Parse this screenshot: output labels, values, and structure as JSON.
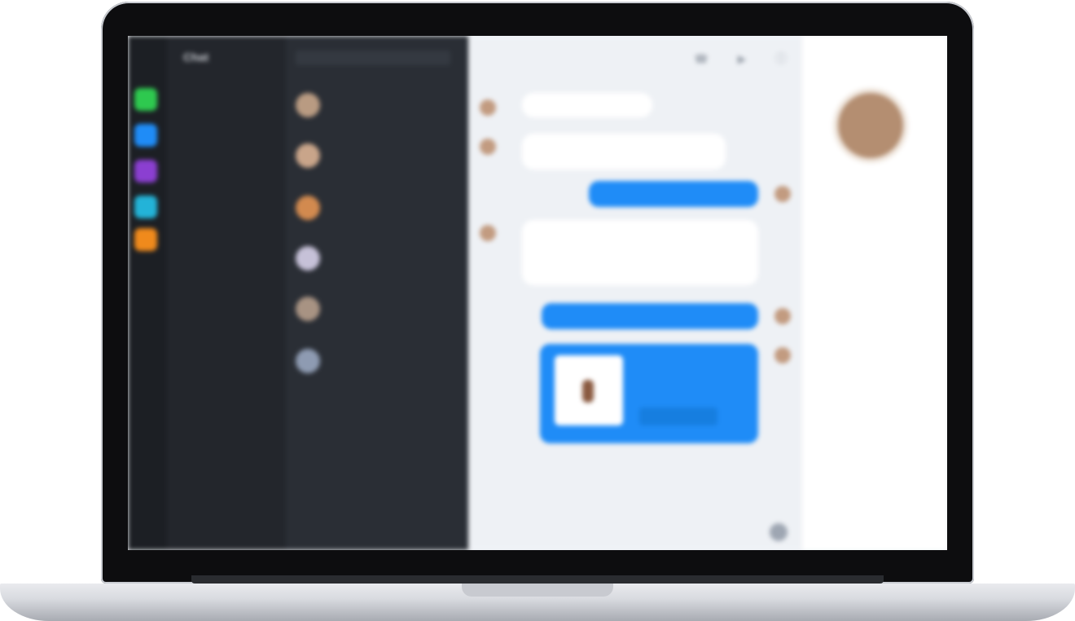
{
  "app": {
    "brand": "Chat",
    "menu_items": [
      "",
      "",
      "",
      "",
      "",
      "",
      "",
      "",
      ""
    ],
    "rail_colors": [
      "#2ec94f",
      "#1f8cf7",
      "#8b3fd1",
      "#23b3d8",
      "#f08a1c"
    ],
    "conversations": [
      {
        "name": "",
        "preview": ""
      },
      {
        "name": "",
        "preview": ""
      },
      {
        "name": "",
        "preview": ""
      },
      {
        "name": "",
        "preview": ""
      },
      {
        "name": "",
        "preview": ""
      },
      {
        "name": "",
        "preview": ""
      }
    ],
    "chat": {
      "title": "",
      "messages": [
        {
          "dir": "in",
          "text": ""
        },
        {
          "dir": "in",
          "text": ""
        },
        {
          "dir": "out",
          "text": ""
        },
        {
          "dir": "in",
          "text": ""
        },
        {
          "dir": "out",
          "text": ""
        }
      ],
      "card": {
        "line1": "",
        "line2": "",
        "button": ""
      },
      "composer_placeholder": ""
    },
    "details": {
      "user_name": "",
      "rows": [
        {
          "key": "",
          "value": ""
        },
        {
          "key": "",
          "value": ""
        },
        {
          "key": "",
          "value": ""
        },
        {
          "key": "",
          "value": ""
        },
        {
          "key": "",
          "value": ""
        }
      ]
    }
  },
  "colors": {
    "accent": "#1f8cf7",
    "sidebar_dark": "#23262c",
    "list_dark": "#2a2e35",
    "chat_bg": "#eef1f5"
  }
}
